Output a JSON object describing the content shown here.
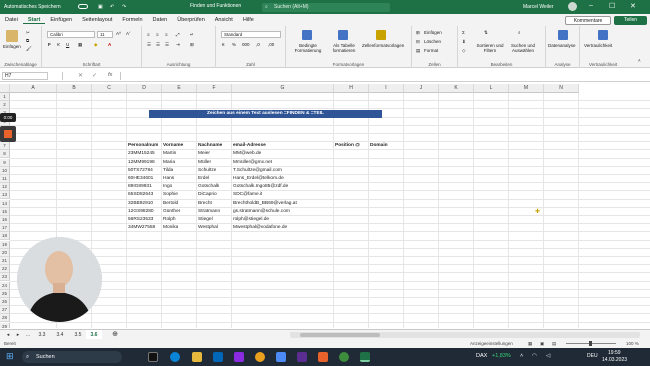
{
  "titlebar": {
    "autosave": "Automatisches Speichern",
    "filename": "Finden und Funktionen",
    "search_placeholder": "Suchen (Alt+M)",
    "user": "Marcel Weiler"
  },
  "menu_tabs": [
    "Datei",
    "Start",
    "Einfügen",
    "Seitenlayout",
    "Formeln",
    "Daten",
    "Überprüfen",
    "Ansicht",
    "Hilfe"
  ],
  "active_tab": "Start",
  "actions": {
    "comments": "Kommentare",
    "share": "Teilen"
  },
  "ribbon": {
    "groups": [
      "Zwischenablage",
      "Schriftart",
      "Ausrichtung",
      "Zahl",
      "Formatvorlagen",
      "Zellen",
      "Bearbeiten",
      "Analyse",
      "Vertraulichkeit"
    ],
    "paste": "Einfügen",
    "font_name": "Calibri",
    "font_size": "11",
    "number_format": "Standard",
    "cond_format": "Bedingte Formatierung",
    "as_table": "Als Tabelle formatieren",
    "cell_styles": "Zellenformatvorlagen",
    "insert": "Einfügen",
    "delete": "Löschen",
    "format": "Format",
    "sort_filter": "Sortieren und Filtern",
    "find_select": "Suchen und Auswählen",
    "data_analysis": "Datenanalyse",
    "sensitivity": "Vertraulichkeit"
  },
  "formula_bar": {
    "namebox": "H7",
    "fx": "fx",
    "content": ""
  },
  "columns": [
    "A",
    "B",
    "C",
    "D",
    "E",
    "F",
    "G",
    "H",
    "I",
    "J",
    "K",
    "L",
    "M",
    "N"
  ],
  "rows": [
    "1",
    "2",
    "3",
    "4",
    "5",
    "6",
    "7",
    "8",
    "9",
    "10",
    "11",
    "12",
    "13",
    "14",
    "15",
    "16",
    "17",
    "18",
    "19",
    "20",
    "21",
    "22",
    "23",
    "24",
    "25",
    "26",
    "27",
    "28",
    "29"
  ],
  "banner": "Zeichen aus einem Text auslesen  =FINDEN & =TEIL",
  "table_headers": [
    "Personalnum",
    "Vorname",
    "Nachname",
    "email-Adresse",
    "Position @",
    "Domain"
  ],
  "table_rows": [
    [
      "23MM15245",
      "Martin",
      "Meier",
      "MM@web.de"
    ],
    [
      "12MM99198",
      "Maria",
      "Müller",
      "Mmüller@gmx.net"
    ],
    [
      "50TS72784",
      "Tilda",
      "Schultze",
      "T.Schultze@gmail.com"
    ],
    [
      "60HE34601",
      "Hans",
      "Erdel",
      "Hans_Erdel@telkom.de"
    ],
    [
      "89IG89931",
      "Ingo",
      "Gotschalk",
      "Gotschalk.Ingo85@zdf.de"
    ],
    [
      "65SD82643",
      "Sophie",
      "DiCaprio",
      "SDC@fame.it"
    ],
    [
      "32BB92910",
      "Bertold",
      "Brecht",
      "BrechtholdB_BB69@verlag.at"
    ],
    [
      "12GS98280",
      "Günther",
      "Stratmann",
      "gs.stratmann@schule.com"
    ],
    [
      "56RS23533",
      "Rolph",
      "Stiegel",
      "rolph@stiegel.de"
    ],
    [
      "34MW27558",
      "Monika",
      "Westphal",
      "Mwestphal@vodafone.de"
    ]
  ],
  "side_indicator": "0:00",
  "sheet_tabs": [
    "3.3",
    "3.4",
    "3.5",
    "3.6"
  ],
  "active_sheet": "3.6",
  "status": {
    "left": "Bereit",
    "accessibility": "Anzeigeeinstellungen",
    "zoom": "100 %"
  },
  "taskbar": {
    "search": "Suchen",
    "ticker": "DAX",
    "ticker_change": "+1,83%",
    "lang": "DEU",
    "time": "19:59",
    "date": "14.03.2023"
  },
  "colors": {
    "excel_green": "#1e7145",
    "banner_blue": "#2f5597",
    "taskbar": "#1f2a36"
  }
}
